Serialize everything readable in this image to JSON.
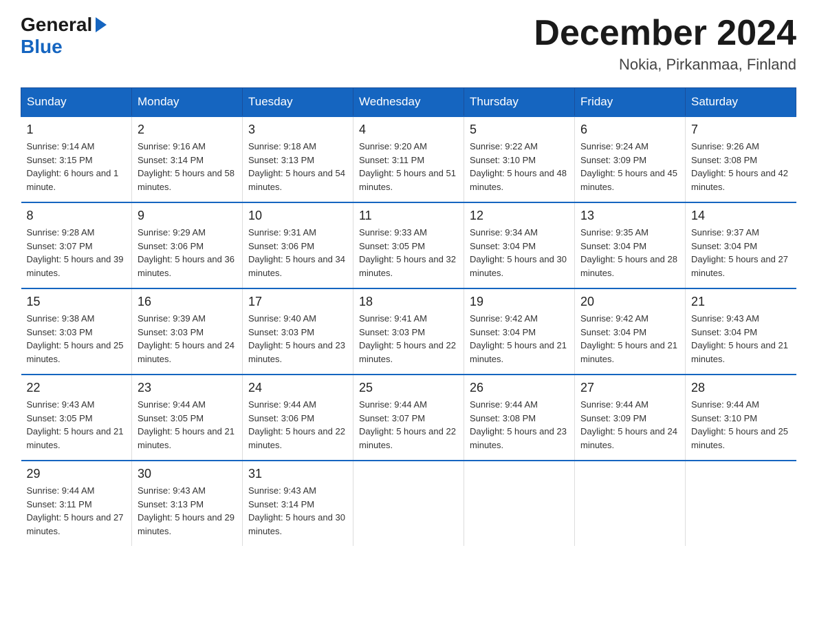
{
  "logo": {
    "general": "General",
    "blue": "Blue"
  },
  "title": "December 2024",
  "location": "Nokia, Pirkanmaa, Finland",
  "days_header": [
    "Sunday",
    "Monday",
    "Tuesday",
    "Wednesday",
    "Thursday",
    "Friday",
    "Saturday"
  ],
  "weeks": [
    [
      {
        "day": "1",
        "sunrise": "9:14 AM",
        "sunset": "3:15 PM",
        "daylight": "6 hours and 1 minute."
      },
      {
        "day": "2",
        "sunrise": "9:16 AM",
        "sunset": "3:14 PM",
        "daylight": "5 hours and 58 minutes."
      },
      {
        "day": "3",
        "sunrise": "9:18 AM",
        "sunset": "3:13 PM",
        "daylight": "5 hours and 54 minutes."
      },
      {
        "day": "4",
        "sunrise": "9:20 AM",
        "sunset": "3:11 PM",
        "daylight": "5 hours and 51 minutes."
      },
      {
        "day": "5",
        "sunrise": "9:22 AM",
        "sunset": "3:10 PM",
        "daylight": "5 hours and 48 minutes."
      },
      {
        "day": "6",
        "sunrise": "9:24 AM",
        "sunset": "3:09 PM",
        "daylight": "5 hours and 45 minutes."
      },
      {
        "day": "7",
        "sunrise": "9:26 AM",
        "sunset": "3:08 PM",
        "daylight": "5 hours and 42 minutes."
      }
    ],
    [
      {
        "day": "8",
        "sunrise": "9:28 AM",
        "sunset": "3:07 PM",
        "daylight": "5 hours and 39 minutes."
      },
      {
        "day": "9",
        "sunrise": "9:29 AM",
        "sunset": "3:06 PM",
        "daylight": "5 hours and 36 minutes."
      },
      {
        "day": "10",
        "sunrise": "9:31 AM",
        "sunset": "3:06 PM",
        "daylight": "5 hours and 34 minutes."
      },
      {
        "day": "11",
        "sunrise": "9:33 AM",
        "sunset": "3:05 PM",
        "daylight": "5 hours and 32 minutes."
      },
      {
        "day": "12",
        "sunrise": "9:34 AM",
        "sunset": "3:04 PM",
        "daylight": "5 hours and 30 minutes."
      },
      {
        "day": "13",
        "sunrise": "9:35 AM",
        "sunset": "3:04 PM",
        "daylight": "5 hours and 28 minutes."
      },
      {
        "day": "14",
        "sunrise": "9:37 AM",
        "sunset": "3:04 PM",
        "daylight": "5 hours and 27 minutes."
      }
    ],
    [
      {
        "day": "15",
        "sunrise": "9:38 AM",
        "sunset": "3:03 PM",
        "daylight": "5 hours and 25 minutes."
      },
      {
        "day": "16",
        "sunrise": "9:39 AM",
        "sunset": "3:03 PM",
        "daylight": "5 hours and 24 minutes."
      },
      {
        "day": "17",
        "sunrise": "9:40 AM",
        "sunset": "3:03 PM",
        "daylight": "5 hours and 23 minutes."
      },
      {
        "day": "18",
        "sunrise": "9:41 AM",
        "sunset": "3:03 PM",
        "daylight": "5 hours and 22 minutes."
      },
      {
        "day": "19",
        "sunrise": "9:42 AM",
        "sunset": "3:04 PM",
        "daylight": "5 hours and 21 minutes."
      },
      {
        "day": "20",
        "sunrise": "9:42 AM",
        "sunset": "3:04 PM",
        "daylight": "5 hours and 21 minutes."
      },
      {
        "day": "21",
        "sunrise": "9:43 AM",
        "sunset": "3:04 PM",
        "daylight": "5 hours and 21 minutes."
      }
    ],
    [
      {
        "day": "22",
        "sunrise": "9:43 AM",
        "sunset": "3:05 PM",
        "daylight": "5 hours and 21 minutes."
      },
      {
        "day": "23",
        "sunrise": "9:44 AM",
        "sunset": "3:05 PM",
        "daylight": "5 hours and 21 minutes."
      },
      {
        "day": "24",
        "sunrise": "9:44 AM",
        "sunset": "3:06 PM",
        "daylight": "5 hours and 22 minutes."
      },
      {
        "day": "25",
        "sunrise": "9:44 AM",
        "sunset": "3:07 PM",
        "daylight": "5 hours and 22 minutes."
      },
      {
        "day": "26",
        "sunrise": "9:44 AM",
        "sunset": "3:08 PM",
        "daylight": "5 hours and 23 minutes."
      },
      {
        "day": "27",
        "sunrise": "9:44 AM",
        "sunset": "3:09 PM",
        "daylight": "5 hours and 24 minutes."
      },
      {
        "day": "28",
        "sunrise": "9:44 AM",
        "sunset": "3:10 PM",
        "daylight": "5 hours and 25 minutes."
      }
    ],
    [
      {
        "day": "29",
        "sunrise": "9:44 AM",
        "sunset": "3:11 PM",
        "daylight": "5 hours and 27 minutes."
      },
      {
        "day": "30",
        "sunrise": "9:43 AM",
        "sunset": "3:13 PM",
        "daylight": "5 hours and 29 minutes."
      },
      {
        "day": "31",
        "sunrise": "9:43 AM",
        "sunset": "3:14 PM",
        "daylight": "5 hours and 30 minutes."
      },
      null,
      null,
      null,
      null
    ]
  ]
}
